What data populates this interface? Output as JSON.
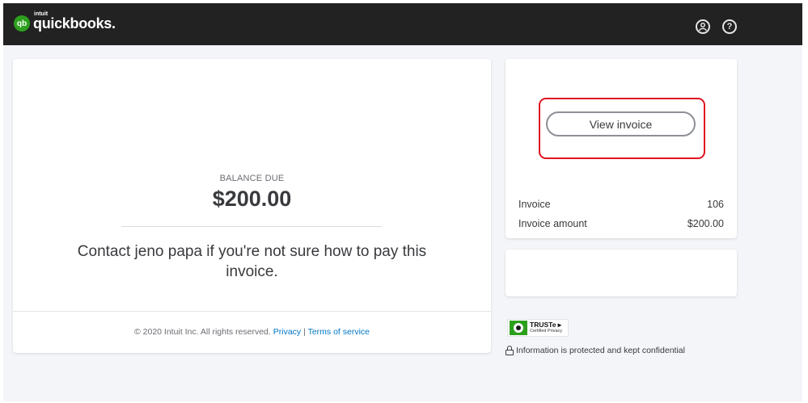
{
  "header": {
    "logo_badge": "qb",
    "logo_intuit": "intuit",
    "logo_word": "quickbooks",
    "logo_period": ".",
    "icons": [
      "account-icon",
      "help-icon"
    ],
    "help_glyph": "?"
  },
  "invoice_summary": {
    "balance_label": "BALANCE DUE",
    "balance_amount": "$200.00",
    "contact_message": "Contact jeno papa if you're not sure how to pay this invoice."
  },
  "footer": {
    "copyright": "© 2020 Intuit Inc. All rights reserved.",
    "privacy_link": "Privacy",
    "separator": "|",
    "terms_link": "Terms of service"
  },
  "side_panel": {
    "view_invoice_label": "View invoice",
    "rows": [
      {
        "label": "Invoice",
        "value": "106"
      },
      {
        "label": "Invoice amount",
        "value": "$200.00"
      }
    ]
  },
  "trust": {
    "badge_brand": "TRUSTe ▸",
    "badge_sub": "Certified Privacy",
    "secure_message": "Information is protected and kept confidential"
  },
  "colors": {
    "topbar": "#222222",
    "brand_green": "#2ca01c",
    "link_blue": "#0077c5",
    "highlight_red": "#e0141e"
  }
}
